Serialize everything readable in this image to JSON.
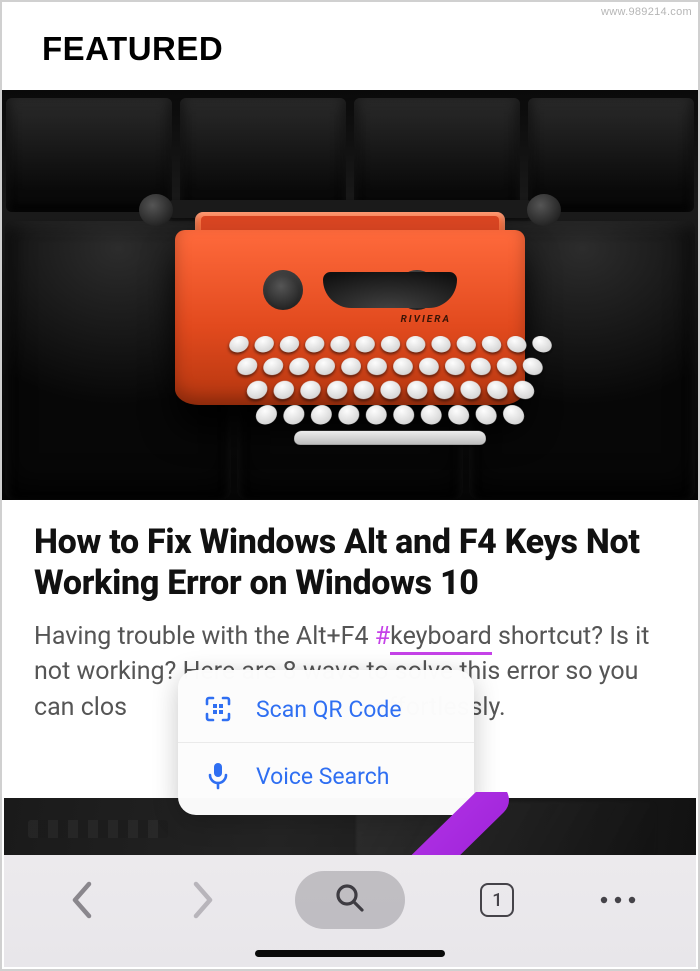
{
  "header": {
    "title": "FEATURED"
  },
  "article": {
    "title": "How to Fix Windows Alt and F4 Keys Not Working Error on Windows 10",
    "body_pre": "Having trouble with the Alt+F4 ",
    "hashtag": "#",
    "keyword": "keyboard",
    "body_mid": " shortcut? Is it not working? Here are 8 wavs to solve this error so you can clos",
    "body_post": "effortlessly."
  },
  "popup": {
    "items": [
      {
        "icon": "qr-icon",
        "label": "Scan QR Code"
      },
      {
        "icon": "mic-icon",
        "label": "Voice Search"
      }
    ]
  },
  "toolbar": {
    "tabs_count": "1"
  },
  "watermark": "www.989214.com"
}
